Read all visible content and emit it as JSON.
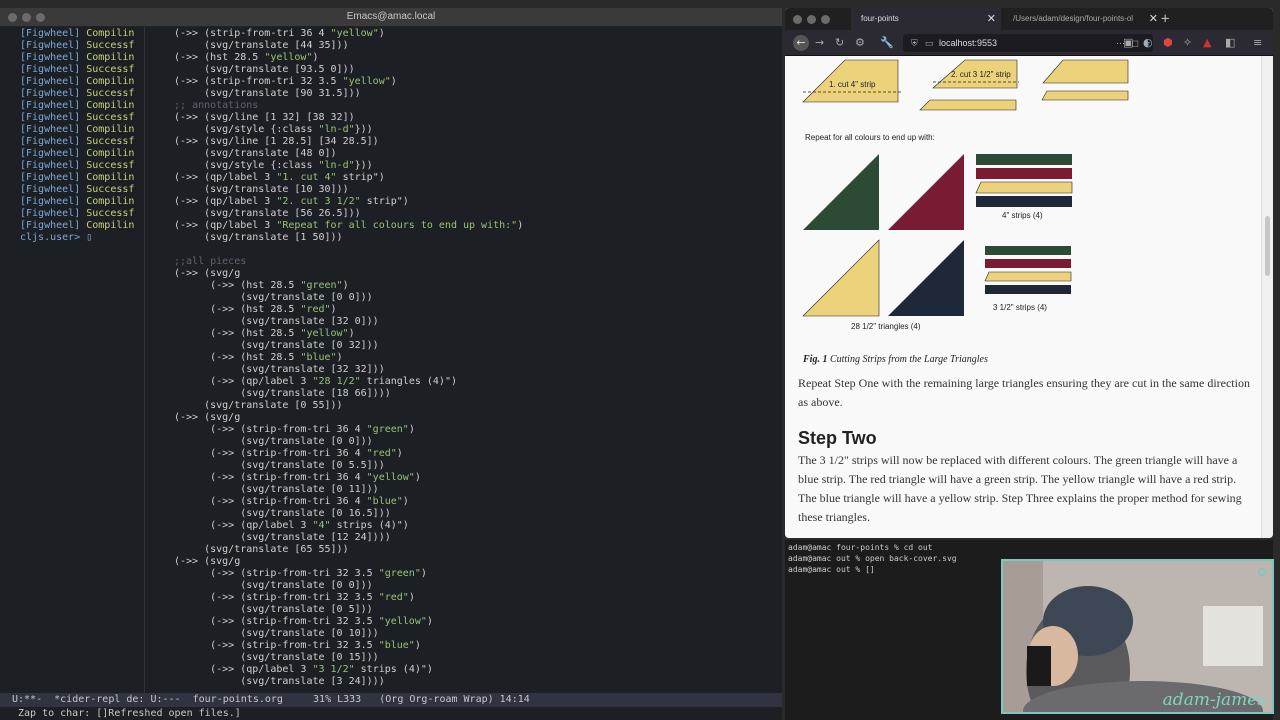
{
  "emacs": {
    "title": "Emacs@amac.local",
    "repl_lines": [
      {
        "tag": "[Figwheel]",
        "msg": "Compilin"
      },
      {
        "tag": "[Figwheel]",
        "msg": "Successf"
      },
      {
        "tag": "[Figwheel]",
        "msg": "Compilin"
      },
      {
        "tag": "[Figwheel]",
        "msg": "Successf"
      },
      {
        "tag": "[Figwheel]",
        "msg": "Compilin"
      },
      {
        "tag": "[Figwheel]",
        "msg": "Successf"
      },
      {
        "tag": "[Figwheel]",
        "msg": "Compilin"
      },
      {
        "tag": "[Figwheel]",
        "msg": "Successf"
      },
      {
        "tag": "[Figwheel]",
        "msg": "Compilin"
      },
      {
        "tag": "[Figwheel]",
        "msg": "Successf"
      },
      {
        "tag": "[Figwheel]",
        "msg": "Compilin"
      },
      {
        "tag": "[Figwheel]",
        "msg": "Successf"
      },
      {
        "tag": "[Figwheel]",
        "msg": "Compilin"
      },
      {
        "tag": "[Figwheel]",
        "msg": "Successf"
      },
      {
        "tag": "[Figwheel]",
        "msg": "Compilin"
      },
      {
        "tag": "[Figwheel]",
        "msg": "Successf"
      },
      {
        "tag": "[Figwheel]",
        "msg": "Compilin"
      }
    ],
    "repl_prompt": "cljs.user>",
    "code_lines": [
      "(->> (strip-from-tri 36 4 \"yellow\")",
      "     (svg/translate [44 35]))",
      "(->> (hst 28.5 \"yellow\")",
      "     (svg/translate [93.5 0]))",
      "(->> (strip-from-tri 32 3.5 \"yellow\")",
      "     (svg/translate [90 31.5]))",
      ";; annotations",
      "(->> (svg/line [1 32] [38 32])",
      "     (svg/style {:class \"ln-d\"}))",
      "(->> (svg/line [1 28.5] [34 28.5])",
      "     (svg/translate [48 0])",
      "     (svg/style {:class \"ln-d\"}))",
      "(->> (qp/label 3 \"1. cut 4\" strip\")",
      "     (svg/translate [10 30]))",
      "(->> (qp/label 3 \"2. cut 3 1/2\" strip\")",
      "     (svg/translate [56 26.5]))",
      "(->> (qp/label 3 \"Repeat for all colours to end up with:\")",
      "     (svg/translate [1 50]))",
      "",
      ";;all pieces",
      "(->> (svg/g",
      "      (->> (hst 28.5 \"green\")",
      "           (svg/translate [0 0]))",
      "      (->> (hst 28.5 \"red\")",
      "           (svg/translate [32 0]))",
      "      (->> (hst 28.5 \"yellow\")",
      "           (svg/translate [0 32]))",
      "      (->> (hst 28.5 \"blue\")",
      "           (svg/translate [32 32]))",
      "      (->> (qp/label 3 \"28 1/2\" triangles (4)\")",
      "           (svg/translate [18 66])))",
      "     (svg/translate [0 55]))",
      "(->> (svg/g",
      "      (->> (strip-from-tri 36 4 \"green\")",
      "           (svg/translate [0 0]))",
      "      (->> (strip-from-tri 36 4 \"red\")",
      "           (svg/translate [0 5.5]))",
      "      (->> (strip-from-tri 36 4 \"yellow\")",
      "           (svg/translate [0 11]))",
      "      (->> (strip-from-tri 36 4 \"blue\")",
      "           (svg/translate [0 16.5]))",
      "      (->> (qp/label 3 \"4\" strips (4)\")",
      "           (svg/translate [12 24])))",
      "     (svg/translate [65 55]))",
      "(->> (svg/g",
      "      (->> (strip-from-tri 32 3.5 \"green\")",
      "           (svg/translate [0 0]))",
      "      (->> (strip-from-tri 32 3.5 \"red\")",
      "           (svg/translate [0 5]))",
      "      (->> (strip-from-tri 32 3.5 \"yellow\")",
      "           (svg/translate [0 10]))",
      "      (->> (strip-from-tri 32 3.5 \"blue\")",
      "           (svg/translate [0 15]))",
      "      (->> (qp/label 3 \"3 1/2\" strips (4)\")",
      "           (svg/translate [3 24])))"
    ],
    "modeline": "U:**-  *cider-repl de: U:---  four-points.org     31% L333   (Org Org-roam Wrap) 14:14",
    "echo": "Zap to char: []Refreshed open files.]"
  },
  "browser": {
    "tab1": "four-points",
    "tab2": "/Users/adam/design/four-points-ol",
    "url": "localhost:9553",
    "figure": {
      "label_cut4": "1. cut 4\" strip",
      "label_cut35": "2. cut 3 1/2\" strip",
      "repeat": "Repeat for all colours to end up with:",
      "strips4": "4\" strips (4)",
      "triangles": "28 1/2\" triangles (4)",
      "strips35": "3 1/2\" strips (4)"
    },
    "fig_caption_num": "Fig. 1",
    "fig_caption_text": "Cutting Strips from the Large Triangles",
    "para1": "Repeat Step One with the remaining large triangles ensuring they are cut in the same direction as above.",
    "heading": "Step Two",
    "para2": "The 3 1/2\" strips will now be replaced with different colours. The green triangle will have a blue strip. The red triangle will have a green strip. The yellow triangle will have a red strip. The blue triangle will have a yellow strip. Step Three explains the proper method for sewing these triangles."
  },
  "terminal": {
    "lines": [
      "adam@amac four-points % cd out",
      "adam@amac out % open back-cover.svg",
      "adam@amac out % []"
    ]
  },
  "colors": {
    "green": "#2d4a35",
    "red": "#7a1a33",
    "yellow": "#ecd27a",
    "blue": "#1e2838"
  }
}
